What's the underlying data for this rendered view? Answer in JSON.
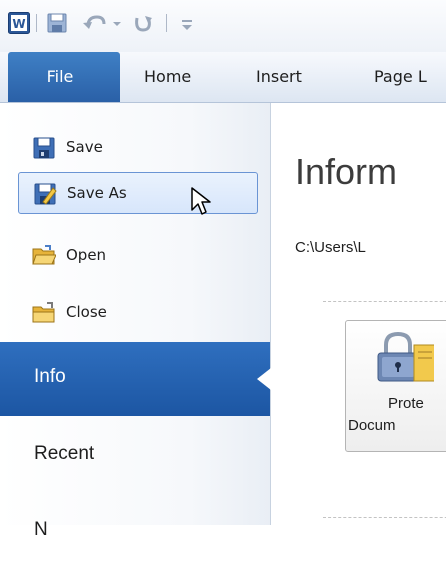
{
  "app": {
    "name": "Microsoft Word"
  },
  "quick_access": {
    "icons": [
      "word-logo-icon",
      "save-icon",
      "undo-icon",
      "dropdown-icon",
      "redo-icon",
      "customize-icon"
    ]
  },
  "tabs": [
    {
      "label": "File"
    },
    {
      "label": "Home"
    },
    {
      "label": "Insert"
    },
    {
      "label": "Page L"
    }
  ],
  "backstage": {
    "commands": [
      {
        "label": "Save",
        "icon": "save-icon"
      },
      {
        "label": "Save As",
        "icon": "save-as-icon",
        "state": "hover"
      },
      {
        "label": "Open",
        "icon": "open-folder-icon"
      },
      {
        "label": "Close",
        "icon": "close-folder-icon"
      }
    ],
    "sections": [
      {
        "label": "Info",
        "selected": true
      },
      {
        "label": "Recent"
      },
      {
        "label": "N"
      }
    ]
  },
  "info": {
    "title": "Inform",
    "path": "C:\\Users\\L",
    "protect_button": {
      "line1": "Prote",
      "line2": "Docum",
      "icon": "lock-icon"
    }
  },
  "colors": {
    "file_tab": "#2a60a7",
    "selected_section": "#1c56a3",
    "hover_border": "#6a94d4",
    "hover_fill": "#d7e6fb"
  }
}
